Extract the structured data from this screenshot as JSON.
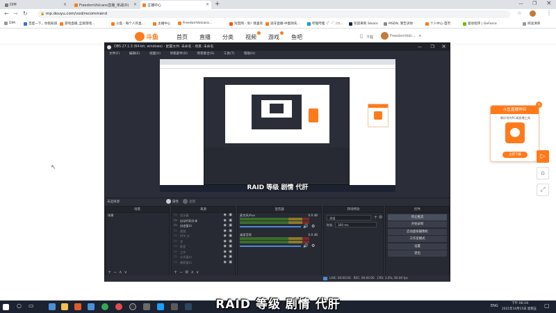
{
  "browser": {
    "tabs": [
      {
        "label": "DIM",
        "active": false
      },
      {
        "label": "FreedomVolcano直播_单战(D)",
        "active": false
      },
      {
        "label": "主播中心",
        "active": true
      }
    ],
    "url": "mp.douyu.com/vod/recommend",
    "bookmarks": [
      "DIM",
      "百度一下，你就知道",
      "游戏直播_全部游戏...",
      "斗鱼 - 每个人的直...",
      "主播中心",
      "FreedomVolcano...",
      "淘宝网 - 淘！我喜欢",
      "逃牙直播-中国领先...",
      "哔哩哔哩（゜-゜)つ...",
      "欢迎来到 Steam",
      "MSDN, 我告诉你",
      "个人中心-首页",
      "驱动程序 | GeForce",
      "阅读清单"
    ]
  },
  "douyu": {
    "logo_text": "斗鱼",
    "nav": [
      "首页",
      "直播",
      "分类",
      "视频",
      "游戏",
      "鱼吧"
    ],
    "download_label": "下载",
    "username": "FreedomVolc..."
  },
  "obs": {
    "title": "OBS 27.1.3 (64-bit, windows) - 配置文件: 未命名 - 场景: 未命名",
    "menu": [
      "文件(F)",
      "编辑(E)",
      "视图(V)",
      "停靠部件(D)",
      "场景集合(S)",
      "工具(T)",
      "帮助(H)"
    ],
    "no_source": "未选择源",
    "properties_label": "属性",
    "filters_label": "滤镜",
    "preview_caption": "RAID 等级 剧情 代肝",
    "panels": {
      "scenes": "场景",
      "sources": "来源",
      "mixer": "混音器",
      "transitions": "转场特效",
      "controls": "控件"
    },
    "scene_items": [
      "场景"
    ],
    "source_items": [
      {
        "label": "显示器",
        "dim": true
      },
      {
        "label": "自动代码文本",
        "dim": false
      },
      {
        "label": "自由窗口",
        "dim": false
      },
      {
        "label": "视频",
        "dim": true
      },
      {
        "label": "RTX 字",
        "dim": true
      },
      {
        "label": "字",
        "dim": true
      },
      {
        "label": "框定",
        "dim": true
      },
      {
        "label": "工作",
        "dim": true
      },
      {
        "label": "计次窗口",
        "dim": true
      },
      {
        "label": "捕获窗口",
        "dim": true
      }
    ],
    "mixer_channels": [
      {
        "name": "麦克风/Aux",
        "level": "0.0 dB"
      },
      {
        "name": "桌面音频",
        "level": "0.0 dB"
      }
    ],
    "transition": {
      "type": "淡出",
      "duration_label": "时长",
      "duration": "300 ms"
    },
    "control_buttons": [
      "停止推流",
      "开始录制",
      "启动虚拟摄像机",
      "工作室模式",
      "设置",
      "退出"
    ],
    "status": "LIVE: 00:00:00   REC: 00:00:00   CPU: 1.0%, 60.00 fps"
  },
  "promo": {
    "title": "斗鱼直播伴侣",
    "subtitle": "最好用的PC端直播工具",
    "button": "立即下载"
  },
  "subtitle": "RAID 等级 剧情 代肝",
  "taskbar": {
    "time": "下午 06:19",
    "date": "2021年10月15日 星期五",
    "lang": "ENG"
  },
  "colors": {
    "brand": "#ff7a1a",
    "obs_bg": "#2b2e38",
    "taskbar": "#1c2230"
  }
}
